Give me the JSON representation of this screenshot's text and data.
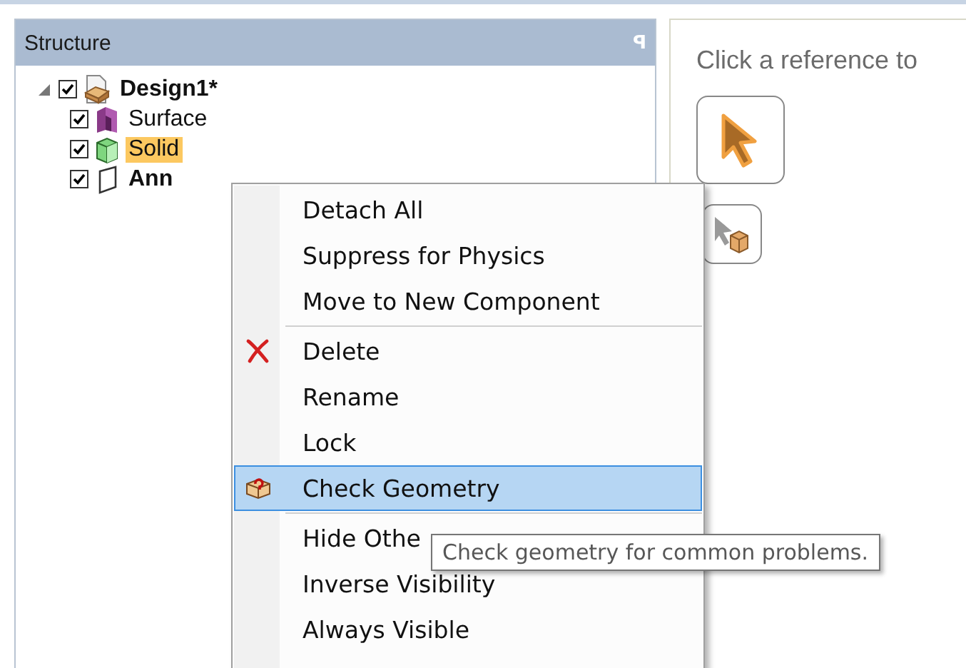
{
  "structure_panel": {
    "title": "Structure",
    "pin": "ꟼ",
    "tree": [
      {
        "label": "Design1*",
        "bold": true,
        "checked": true,
        "expanded": true,
        "selected": false,
        "kind": "design",
        "children": [
          {
            "label": "Surface",
            "bold": false,
            "checked": true,
            "selected": false,
            "kind": "surface"
          },
          {
            "label": "Solid",
            "bold": false,
            "checked": true,
            "selected": true,
            "kind": "solid"
          },
          {
            "label": "Ann",
            "bold": true,
            "checked": true,
            "selected": false,
            "kind": "plane"
          }
        ]
      }
    ]
  },
  "reference_panel": {
    "hint": "Click a reference to"
  },
  "context_menu": {
    "groups": [
      [
        {
          "label": "Detach All",
          "kind": "plain",
          "highlighted": false
        },
        {
          "label": "Suppress for Physics",
          "kind": "plain",
          "highlighted": false
        },
        {
          "label": "Move to New Component",
          "kind": "plain",
          "highlighted": false
        }
      ],
      [
        {
          "label": "Delete",
          "kind": "delete",
          "highlighted": false
        },
        {
          "label": "Rename",
          "kind": "plain",
          "highlighted": false
        },
        {
          "label": "Lock",
          "kind": "plain",
          "highlighted": false
        },
        {
          "label": "Check Geometry",
          "kind": "check",
          "highlighted": true
        }
      ],
      [
        {
          "label": "Hide Othe",
          "kind": "plain",
          "highlighted": false
        },
        {
          "label": "Inverse Visibility",
          "kind": "plain",
          "highlighted": false
        },
        {
          "label": "Always Visible",
          "kind": "plain",
          "highlighted": false
        }
      ]
    ]
  },
  "tooltip": "Check geometry for common problems."
}
